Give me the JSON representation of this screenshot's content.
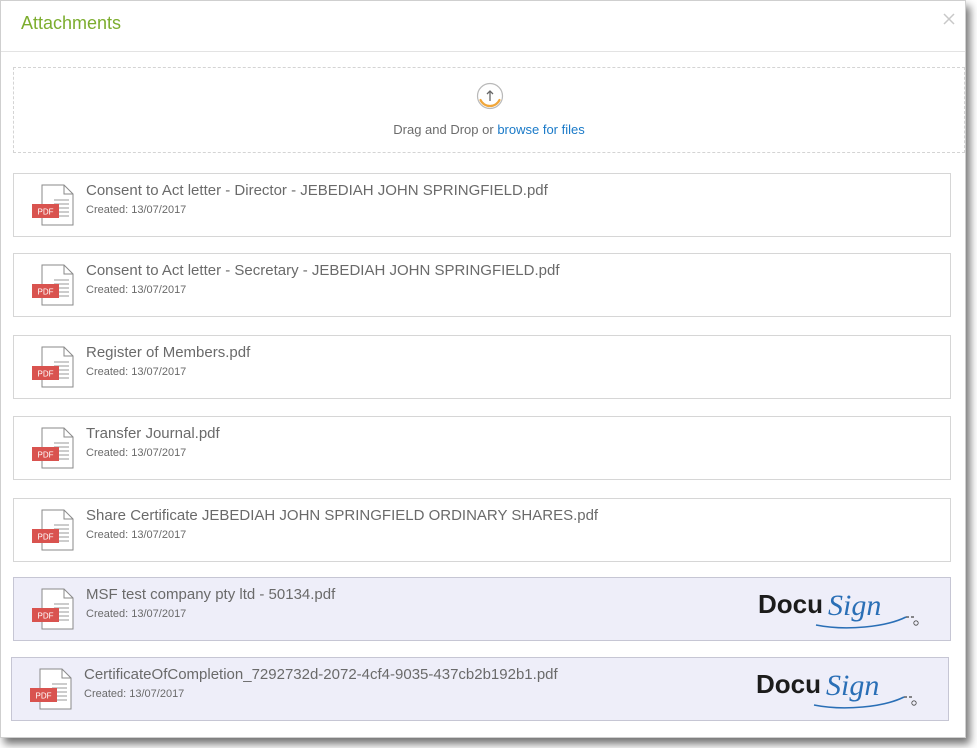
{
  "modal": {
    "title": "Attachments",
    "close_icon": "close-icon"
  },
  "dropzone": {
    "icon": "upload-icon",
    "prefix_text": "Drag and Drop or ",
    "link_text": "browse for files"
  },
  "files": [
    {
      "name": "Consent to Act letter - Director - JEBEDIAH JOHN SPRINGFIELD.pdf",
      "created": "Created: 13/07/2017",
      "badge": "PDF",
      "signed": false
    },
    {
      "name": "Consent to Act letter - Secretary - JEBEDIAH JOHN SPRINGFIELD.pdf",
      "created": "Created: 13/07/2017",
      "badge": "PDF",
      "signed": false
    },
    {
      "name": "Register of Members.pdf",
      "created": "Created: 13/07/2017",
      "badge": "PDF",
      "signed": false
    },
    {
      "name": "Transfer Journal.pdf",
      "created": "Created: 13/07/2017",
      "badge": "PDF",
      "signed": false
    },
    {
      "name": "Share Certificate JEBEDIAH JOHN SPRINGFIELD ORDINARY SHARES.pdf",
      "created": "Created: 13/07/2017",
      "badge": "PDF",
      "signed": false
    },
    {
      "name": "MSF test company pty ltd - 50134.pdf",
      "created": "Created: 13/07/2017",
      "badge": "PDF",
      "signed": true
    },
    {
      "name": "CertificateOfCompletion_7292732d-2072-4cf4-9035-437cb2b192b1.pdf",
      "created": "Created: 13/07/2017",
      "badge": "PDF",
      "signed": true
    }
  ],
  "docusign": {
    "brand_text": "DocuSign",
    "docu_color": "#1c1c1c",
    "sign_color": "#2a6fb6"
  },
  "colors": {
    "title": "#7cad2e",
    "link": "#1a7ac8",
    "pdf_badge": "#d9534f",
    "signed_row_bg": "#eeeef9"
  }
}
